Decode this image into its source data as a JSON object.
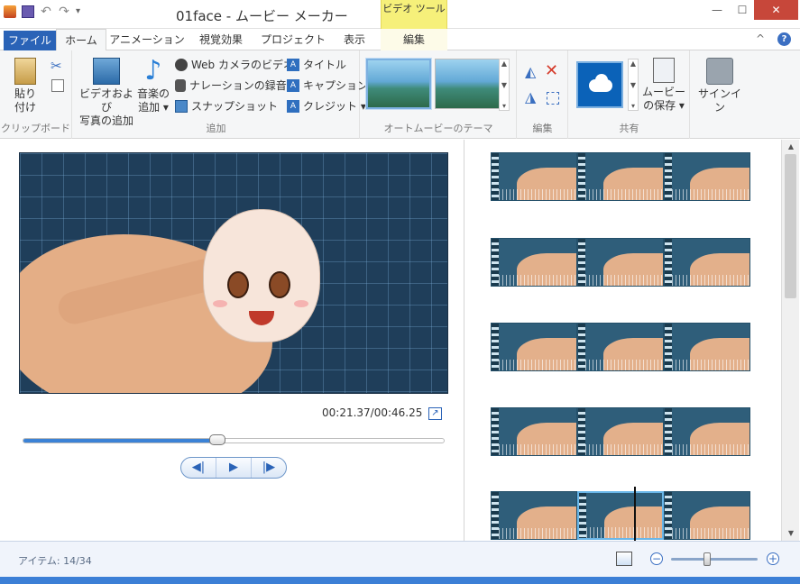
{
  "window": {
    "title": "01face - ムービー メーカー",
    "context_tab_group": "ビデオ ツール",
    "minimize": "—",
    "maximize": "☐",
    "close": "✕"
  },
  "tabs": {
    "file": "ファイル",
    "home": "ホーム",
    "animation": "アニメーション",
    "visual_effects": "視覚効果",
    "project": "プロジェクト",
    "view": "表示",
    "edit": "編集"
  },
  "help": {
    "collapse": "^",
    "help": "?"
  },
  "ribbon": {
    "clipboard": {
      "label": "クリップボード",
      "paste_line1": "貼り",
      "paste_line2": "付け"
    },
    "add": {
      "label": "追加",
      "add_video_line1": "ビデオおよび",
      "add_video_line2": "写真の追加",
      "add_music_line1": "音楽の",
      "add_music_line2": "追加 ▾",
      "webcam": "Web カメラのビデオ",
      "narration": "ナレーションの録音 ▾",
      "snapshot": "スナップショット",
      "title": "タイトル",
      "caption": "キャプション",
      "credit": "クレジット ▾"
    },
    "automovie": {
      "label": "オートムービーのテーマ"
    },
    "edit": {
      "label": "編集"
    },
    "share": {
      "label": "共有",
      "save_line1": "ムービー",
      "save_line2": "の保存 ▾"
    },
    "signin": "サインイン"
  },
  "preview": {
    "timecode": "00:21.37/00:46.25",
    "progress": 0.462
  },
  "status": {
    "items": "アイテム: 14/34",
    "zoom_level": 0.42
  }
}
